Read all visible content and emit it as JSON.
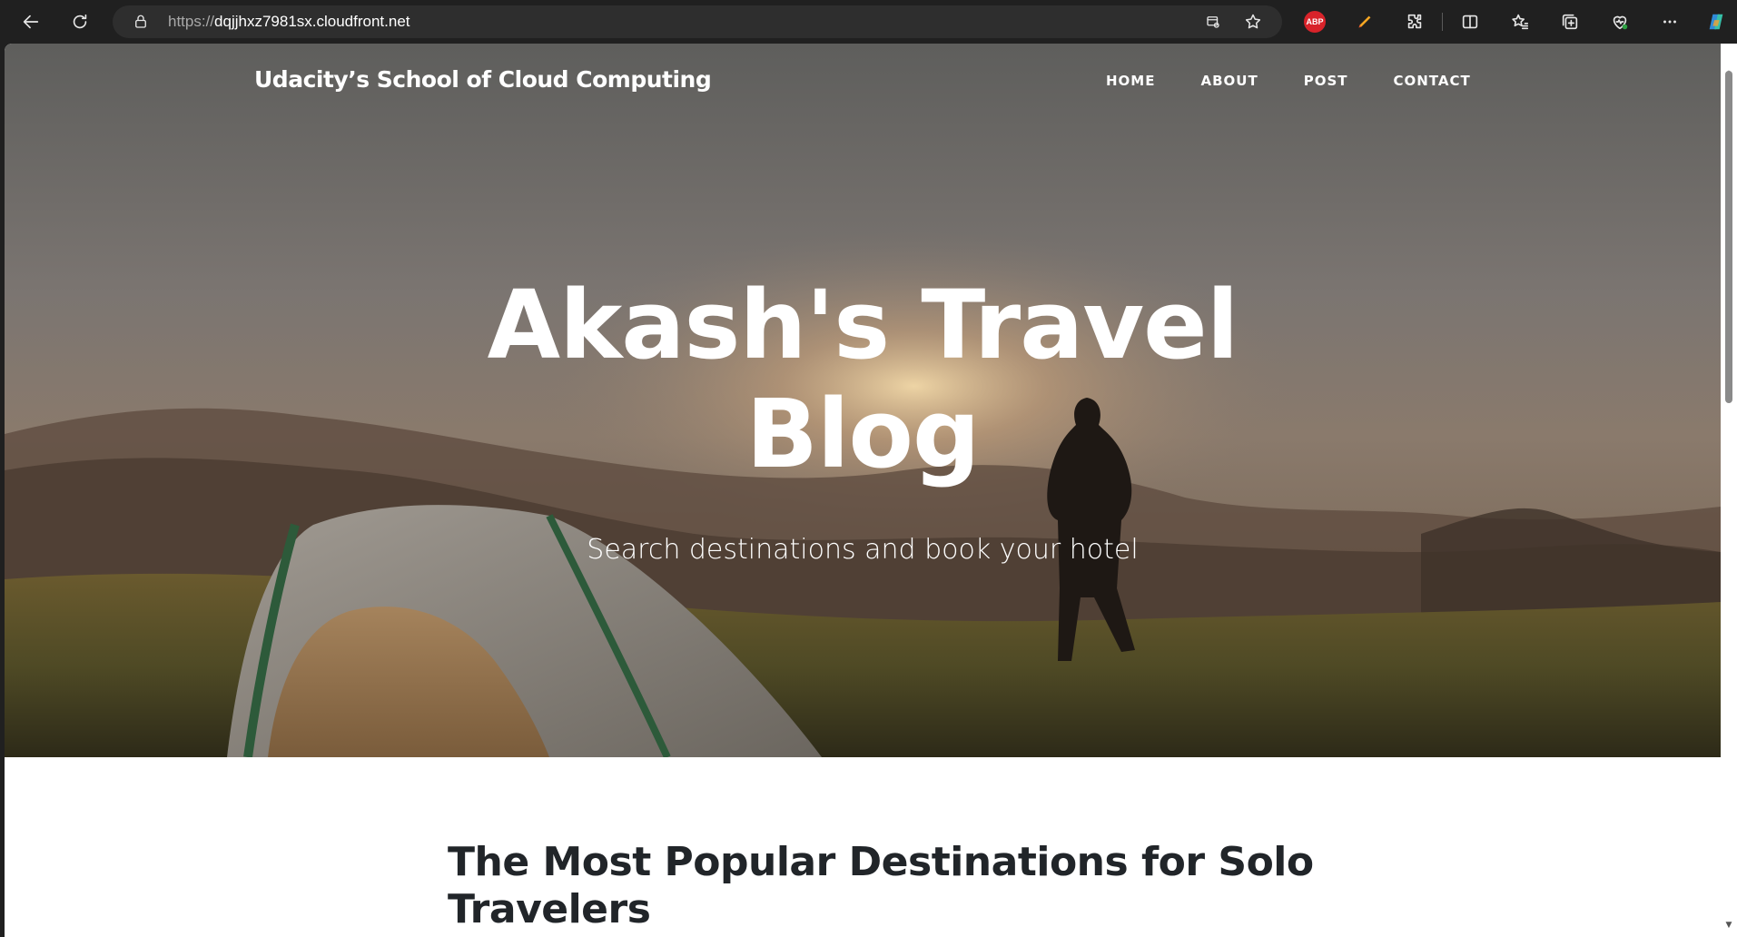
{
  "browser": {
    "url_scheme": "https://",
    "url_host": "dqjjhxz7981sx.cloudfront.net",
    "abp_label": "ABP",
    "icons": [
      "back-arrow-icon",
      "refresh-icon",
      "lock-icon",
      "app-available-icon",
      "favorite-star-icon",
      "adblock-icon",
      "highlighter-icon",
      "extensions-icon",
      "split-screen-icon",
      "favorites-icon",
      "collections-icon",
      "browser-essentials-icon",
      "more-menu-icon",
      "copilot-icon"
    ]
  },
  "site": {
    "brand": "Udacity’s School of Cloud Computing",
    "nav": [
      {
        "label": "Home"
      },
      {
        "label": "About"
      },
      {
        "label": "Post"
      },
      {
        "label": "Contact"
      }
    ]
  },
  "hero": {
    "title_line1": "Akash's Travel",
    "title_line2": "Blog",
    "subtitle": "Search destinations and book your hotel"
  },
  "content": {
    "post_title_line1": "The Most Popular Destinations for Solo",
    "post_title_line2": "Travelers"
  }
}
